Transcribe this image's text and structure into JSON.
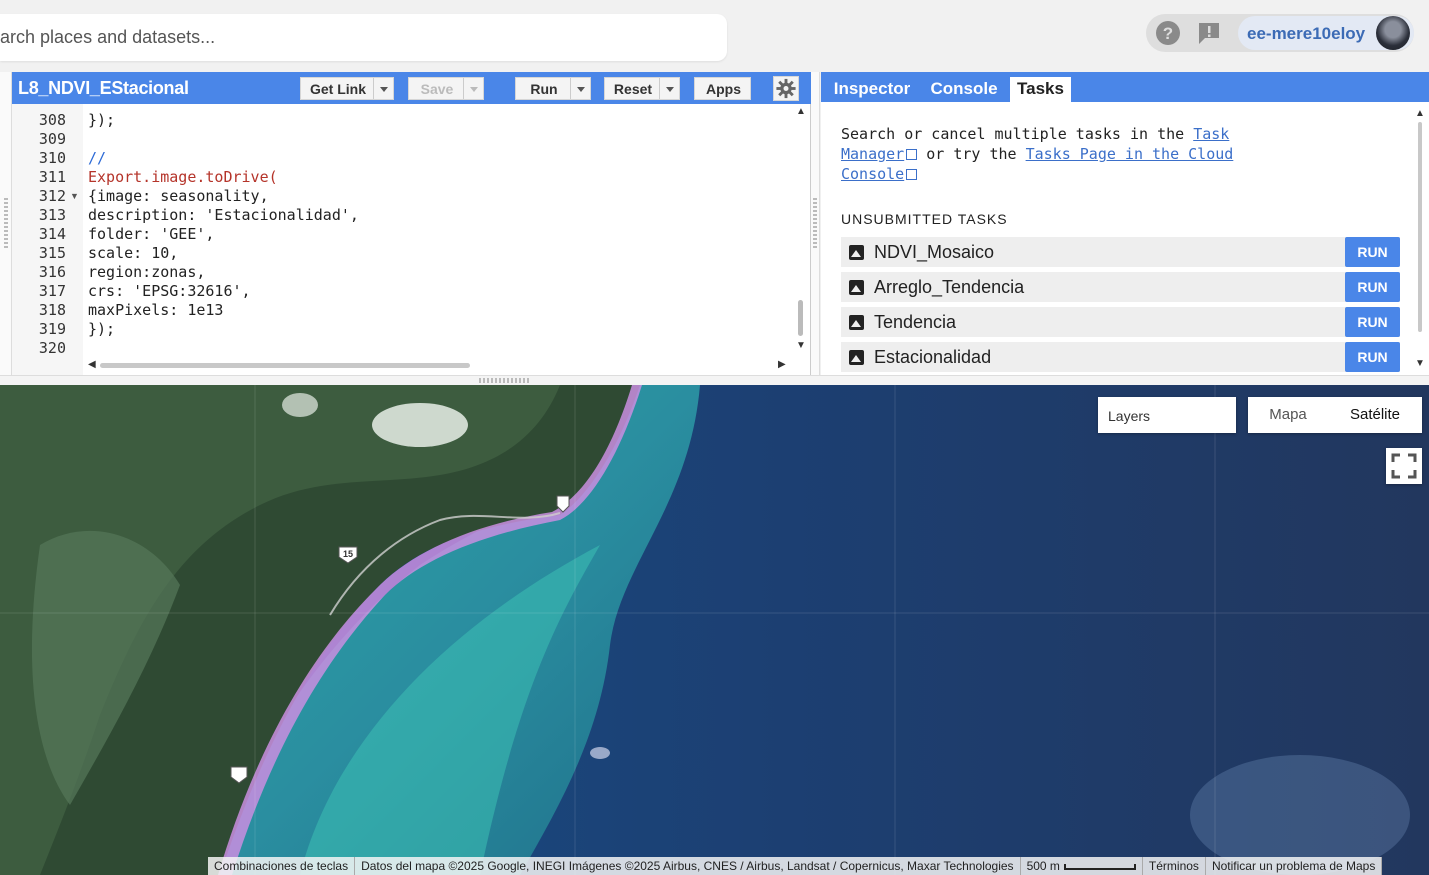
{
  "search": {
    "placeholder": "Search places and datasets..."
  },
  "account": {
    "user": "ee-mere10eloy",
    "help_icon": "help-icon",
    "feedback_icon": "feedback-icon"
  },
  "editor": {
    "script_name": "L8_NDVI_EStacional",
    "buttons": {
      "get_link": "Get Link",
      "save": "Save",
      "run": "Run",
      "reset": "Reset",
      "apps": "Apps"
    },
    "lines": [
      {
        "num": "308",
        "text": "});"
      },
      {
        "num": "309",
        "text": ""
      },
      {
        "num": "310",
        "text": "//"
      },
      {
        "num": "311",
        "text": "Export.image.toDrive("
      },
      {
        "num": "312",
        "text": "{image: seasonality,"
      },
      {
        "num": "313",
        "text": "description: 'Estacionalidad',"
      },
      {
        "num": "314",
        "text": "folder: 'GEE',"
      },
      {
        "num": "315",
        "text": "scale: 10,"
      },
      {
        "num": "316",
        "text": "region:zonas,"
      },
      {
        "num": "317",
        "text": "crs: 'EPSG:32616',"
      },
      {
        "num": "318",
        "text": "maxPixels: 1e13"
      },
      {
        "num": "319",
        "text": "});"
      },
      {
        "num": "320",
        "text": ""
      }
    ]
  },
  "right_panel": {
    "tabs": [
      "Inspector",
      "Console",
      "Tasks"
    ],
    "active_tab": "Tasks",
    "msg": {
      "pre": "Search or cancel multiple tasks in the ",
      "link1": "Task Manager",
      "mid": " or try the ",
      "link2": "Tasks Page in the Cloud Console"
    },
    "section_title": "UNSUBMITTED TASKS",
    "tasks": [
      {
        "name": "NDVI_Mosaico",
        "action": "RUN"
      },
      {
        "name": "Arreglo_Tendencia",
        "action": "RUN"
      },
      {
        "name": "Tendencia",
        "action": "RUN"
      },
      {
        "name": "Estacionalidad",
        "action": "RUN"
      }
    ]
  },
  "map": {
    "layers_label": "Layers",
    "map_types": [
      "Mapa",
      "Satélite"
    ],
    "selected_map_type": "Satélite",
    "road_shields": [
      "15",
      "15",
      "15"
    ],
    "attribution": {
      "shortcuts": "Combinaciones de teclas",
      "data": "Datos del mapa ©2025 Google, INEGI Imágenes ©2025 Airbus, CNES / Airbus, Landsat / Copernicus, Maxar Technologies",
      "scale": "500 m",
      "terms": "Términos",
      "report": "Notificar un problema de Maps"
    }
  }
}
